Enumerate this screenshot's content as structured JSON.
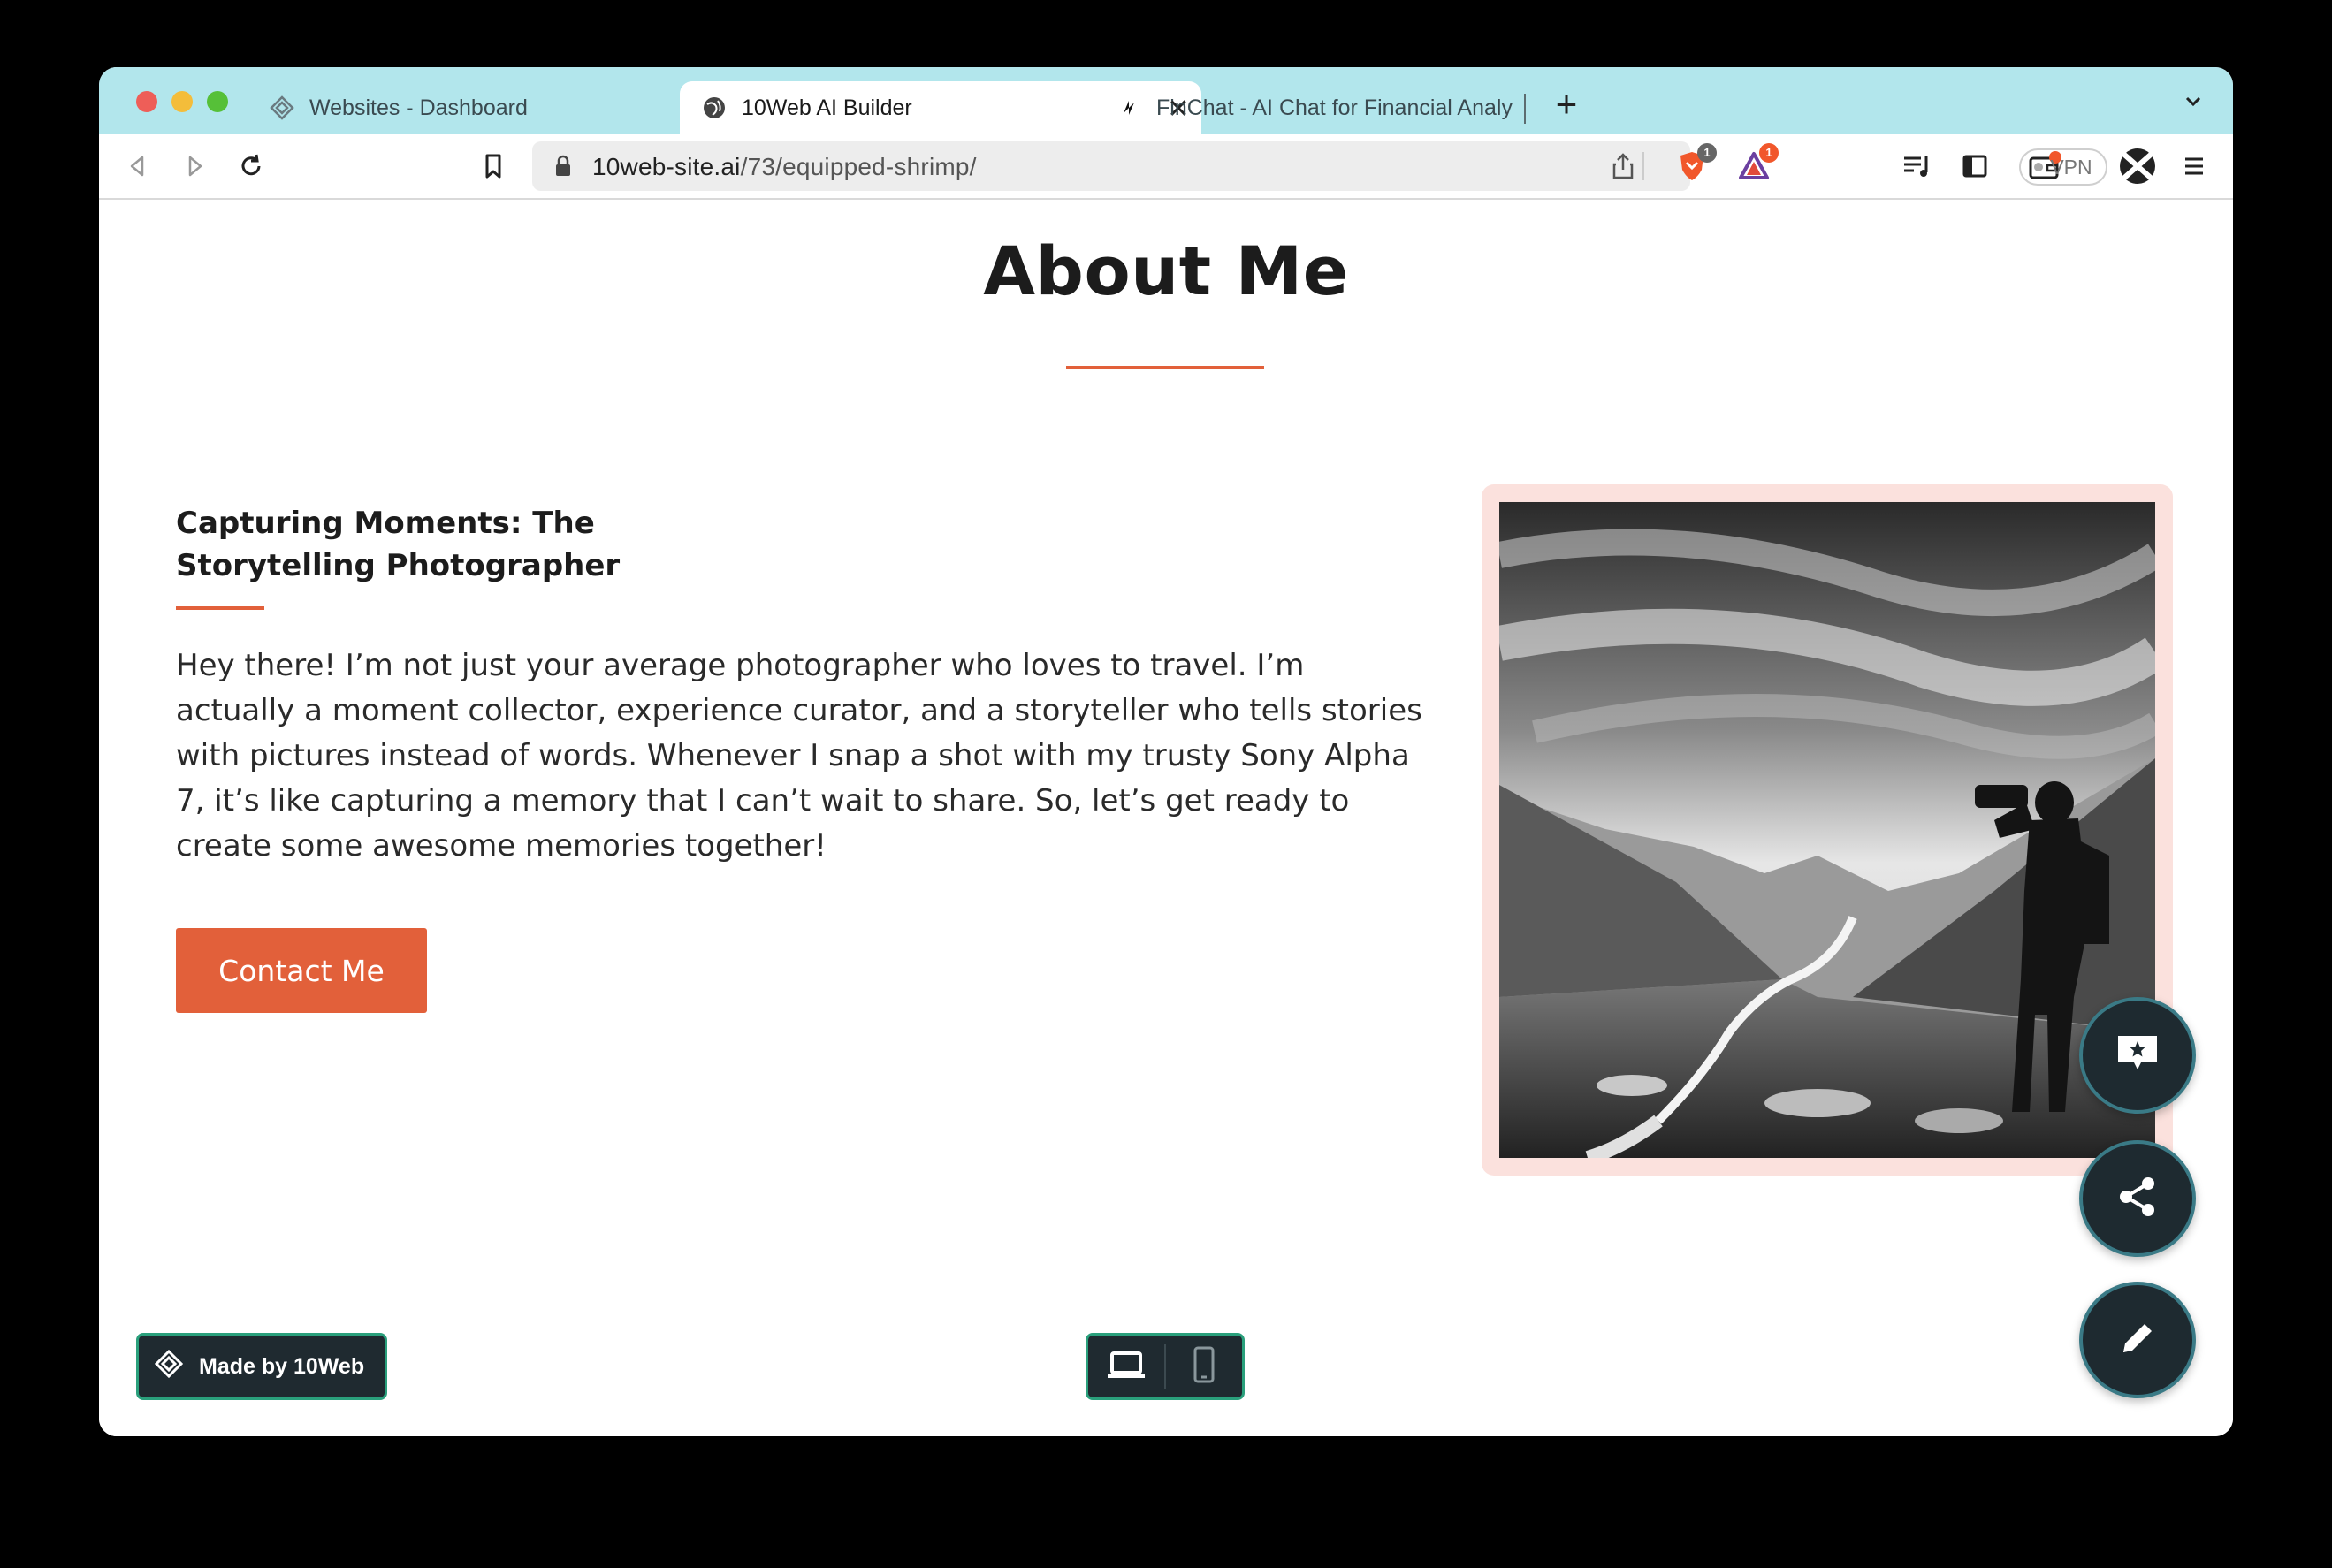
{
  "browser": {
    "tabs": [
      {
        "label": "Websites - Dashboard"
      },
      {
        "label": "10Web AI Builder",
        "active": true
      },
      {
        "label": "FinChat - AI Chat for Financial Analy"
      }
    ],
    "url_host": "10web-site.ai",
    "url_path": "/73/equipped-shrimp/",
    "vpn_label": "VPN",
    "shield_badge": "1",
    "rewards_badge": "1"
  },
  "page": {
    "title": "About Me",
    "subtitle": "Capturing Moments: The\nStorytelling Photographer",
    "body": "Hey there! I’m not just your average photographer who loves to travel. I’m actually a moment collector, experience curator, and a storyteller who tells stories with pictures instead of words. Whenever I snap a shot with my trusty Sony Alpha 7, it’s like capturing a memory that I can’t wait to share. So, let’s get ready to create some awesome memories together!",
    "cta_label": "Contact Me"
  },
  "overlay": {
    "made_by_label": "Made by 10Web"
  },
  "colors": {
    "accent": "#e2603a",
    "tabstrip": "#b2e6ec",
    "frame": "#fbe1dd",
    "fab_bg": "#1e2a30"
  }
}
